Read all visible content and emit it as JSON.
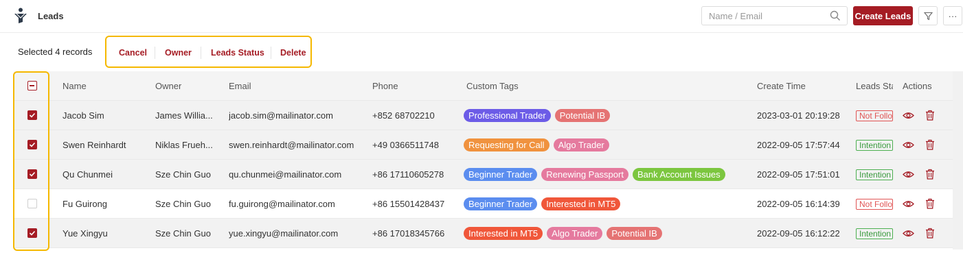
{
  "header": {
    "title": "Leads",
    "search_placeholder": "Name / Email",
    "create_label": "Create Leads",
    "more_label": "···"
  },
  "selection": {
    "text": "Selected 4 records",
    "actions": [
      "Cancel",
      "Owner",
      "Leads Status",
      "Delete"
    ]
  },
  "table": {
    "columns": [
      "Name",
      "Owner",
      "Email",
      "Phone",
      "Custom Tags",
      "Create Time",
      "Leads Sta",
      "Actions"
    ],
    "rows": [
      {
        "checked": true,
        "name": "Jacob Sim",
        "owner": "James Willia...",
        "email": "jacob.sim@mailinator.com",
        "phone": "+852 68702210",
        "tags": [
          {
            "label": "Professional Trader",
            "color": "#6c5ce7"
          },
          {
            "label": "Potential IB",
            "color": "#e57373"
          }
        ],
        "time": "2023-03-01 20:19:28",
        "status": "Not Follo",
        "status_color": "red"
      },
      {
        "checked": true,
        "name": "Swen Reinhardt",
        "owner": "Niklas Frueh...",
        "email": "swen.reinhardt@mailinator.com",
        "phone": "+49 0366511748",
        "tags": [
          {
            "label": "Requesting for Call",
            "color": "#f0923e"
          },
          {
            "label": "Algo Trader",
            "color": "#e57a9e"
          }
        ],
        "time": "2022-09-05 17:57:44",
        "status": "Intention",
        "status_color": "green"
      },
      {
        "checked": true,
        "name": "Qu Chunmei",
        "owner": "Sze Chin Guo",
        "email": "qu.chunmei@mailinator.com",
        "phone": "+86 17110605278",
        "tags": [
          {
            "label": "Beginner Trader",
            "color": "#5b8def"
          },
          {
            "label": "Renewing Passport",
            "color": "#e57a9e"
          },
          {
            "label": "Bank Account Issues",
            "color": "#7cc63f"
          }
        ],
        "time": "2022-09-05 17:51:01",
        "status": "Intention",
        "status_color": "green"
      },
      {
        "checked": false,
        "name": "Fu Guirong",
        "owner": "Sze Chin Guo",
        "email": "fu.guirong@mailinator.com",
        "phone": "+86 15501428437",
        "tags": [
          {
            "label": "Beginner Trader",
            "color": "#5b8def"
          },
          {
            "label": "Interested in MT5",
            "color": "#f0573a"
          }
        ],
        "time": "2022-09-05 16:14:39",
        "status": "Not Follo",
        "status_color": "red"
      },
      {
        "checked": true,
        "name": "Yue Xingyu",
        "owner": "Sze Chin Guo",
        "email": "yue.xingyu@mailinator.com",
        "phone": "+86 17018345766",
        "tags": [
          {
            "label": "Interested in MT5",
            "color": "#f0573a"
          },
          {
            "label": "Algo Trader",
            "color": "#e57a9e"
          },
          {
            "label": "Potential IB",
            "color": "#e57373"
          }
        ],
        "time": "2022-09-05 16:12:22",
        "status": "Intention",
        "status_color": "green"
      }
    ]
  },
  "colors": {
    "brand": "#a51c24",
    "highlight": "#f5b800"
  }
}
